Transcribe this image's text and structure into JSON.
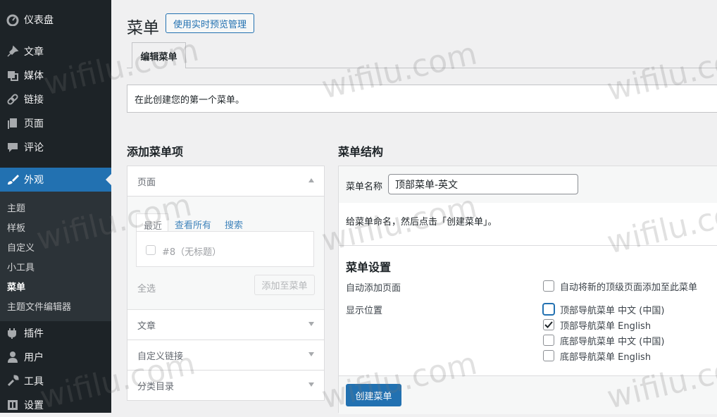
{
  "sidebar": {
    "items": [
      {
        "label": "仪表盘",
        "icon": "dashboard-icon"
      },
      {
        "label": "文章",
        "icon": "pin-icon"
      },
      {
        "label": "媒体",
        "icon": "media-icon"
      },
      {
        "label": "链接",
        "icon": "link-icon"
      },
      {
        "label": "页面",
        "icon": "page-icon"
      },
      {
        "label": "评论",
        "icon": "comment-icon"
      },
      {
        "label": "外观",
        "icon": "brush-icon"
      },
      {
        "label": "插件",
        "icon": "plugin-icon"
      },
      {
        "label": "用户",
        "icon": "user-icon"
      },
      {
        "label": "工具",
        "icon": "wrench-icon"
      },
      {
        "label": "设置",
        "icon": "settings-icon"
      }
    ],
    "submenu": [
      "主题",
      "样板",
      "自定义",
      "小工具",
      "菜单",
      "主题文件编辑器"
    ]
  },
  "header": {
    "title": "菜单",
    "preview_button": "使用实时预览管理",
    "tab": "编辑菜单"
  },
  "notice": "在此创建您的第一个菜单。",
  "add_panel": {
    "title": "添加菜单项",
    "sections": [
      "页面",
      "文章",
      "自定义链接",
      "分类目录"
    ],
    "subtabs": [
      "最近",
      "查看所有",
      "搜索"
    ],
    "page_item": "#8（无标题）",
    "select_all": "全选",
    "add_button": "添加至菜单"
  },
  "structure": {
    "title": "菜单结构",
    "name_label": "菜单名称",
    "name_value": "顶部菜单-英文",
    "hint": "给菜单命名，然后点击「创建菜单」。",
    "settings_title": "菜单设置",
    "auto_add_label": "自动添加页面",
    "auto_add_option": "自动将新的顶级页面添加至此菜单",
    "location_label": "显示位置",
    "locations": [
      {
        "label": "顶部导航菜单 中文 (中国)",
        "checked": false
      },
      {
        "label": "顶部导航菜单 English",
        "checked": true
      },
      {
        "label": "底部导航菜单 中文 (中国)",
        "checked": false
      },
      {
        "label": "底部导航菜单 English",
        "checked": false
      }
    ],
    "create_button": "创建菜单"
  },
  "watermark": "wifilu.com",
  "colors": {
    "accent": "#2271b1",
    "sidebar": "#1d2327",
    "submenu": "#2c3338"
  }
}
